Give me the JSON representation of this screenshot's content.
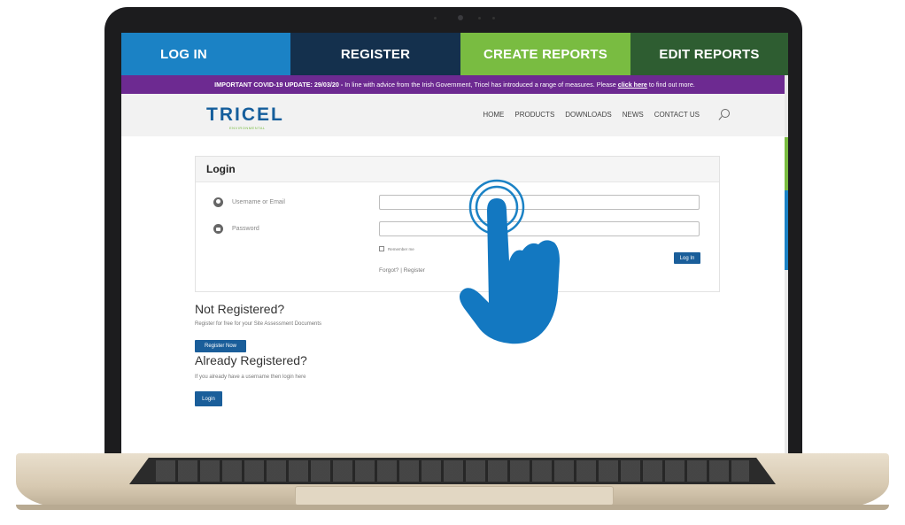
{
  "topnav": {
    "items": [
      "LOG IN",
      "REGISTER",
      "CREATE REPORTS",
      "EDIT REPORTS"
    ],
    "colors": [
      "#1b82c5",
      "#14304d",
      "#79bc41",
      "#2e5d31"
    ]
  },
  "banner": {
    "prefix": "IMPORTANT COVID-19 UPDATE: 29/03/20 -",
    "text": " In line with advice from the Irish Government, Tricel has introduced a range of measures. Please ",
    "link": "click here",
    "suffix": " to find out more.",
    "color": "#6d2a91"
  },
  "header": {
    "logo": "TRICEL",
    "logo_sub": "ENVIRONMENTAL",
    "menu": [
      "HOME",
      "PRODUCTS",
      "DOWNLOADS",
      "NEWS",
      "CONTACT US"
    ],
    "search_icon": "search-icon"
  },
  "login": {
    "title": "Login",
    "username_label": "Username or Email",
    "password_label": "Password",
    "remember": "Remember me",
    "button": "Log In",
    "forgot": "Forgot?",
    "separator": "|",
    "register_link": "Register"
  },
  "not_registered": {
    "title": "Not Registered?",
    "text": "Register for free for your Site Assessment Documents",
    "button": "Register Now"
  },
  "already_registered": {
    "title": "Already Registered?",
    "text": "If you already have a username then login here",
    "button": "Login"
  },
  "overlay": {
    "icon": "tap-hand-icon",
    "color": "#1b82c5"
  }
}
